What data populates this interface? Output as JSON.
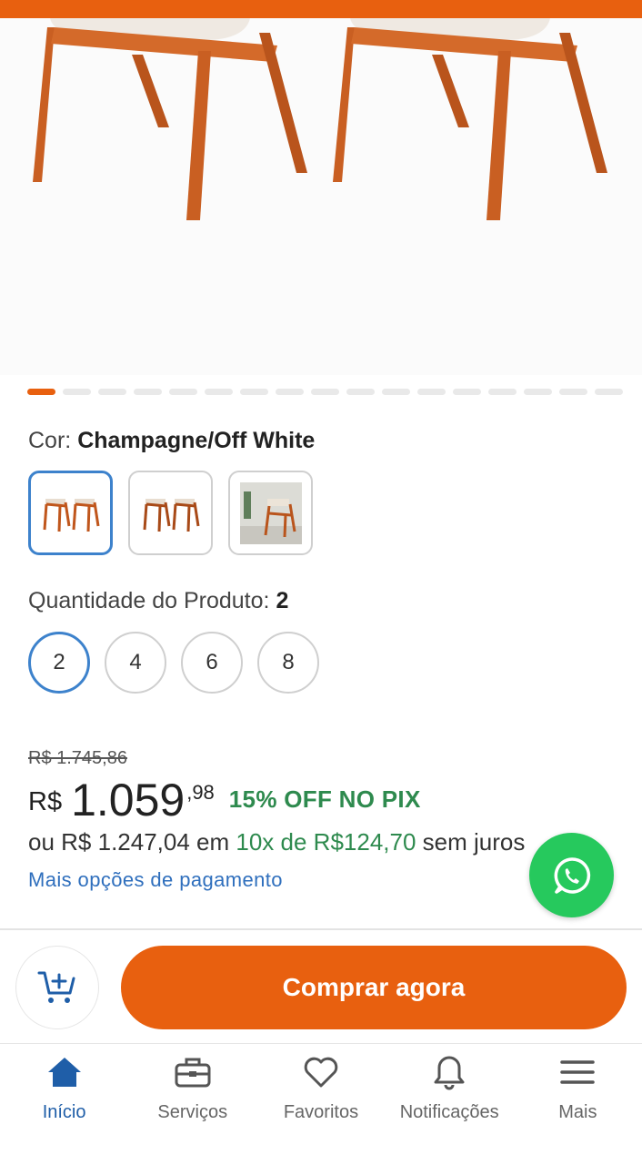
{
  "colors": {
    "accent": "#e8600f",
    "selected_border": "#3d82cc",
    "green": "#2e8a4e",
    "link_blue": "#2f6fbd",
    "nav_active": "#1f5ea8",
    "whatsapp": "#26c95d"
  },
  "carousel": {
    "total_slides": 17,
    "active_index": 0
  },
  "color_selector": {
    "label": "Cor:",
    "value": "Champagne/Off White",
    "swatches": [
      "chairs-pair-front",
      "chairs-pair-side",
      "chair-room-scene"
    ],
    "selected_index": 0
  },
  "quantity": {
    "label": "Quantidade do Produto:",
    "value": "2",
    "options": [
      "2",
      "4",
      "6",
      "8"
    ],
    "selected_index": 0
  },
  "price": {
    "old": "R$ 1.745,86",
    "currency": "R$",
    "main": "1.059",
    "cents": ",98",
    "pix_off": "15% OFF NO PIX",
    "installments_prefix": "ou R$ 1.247,04 em",
    "installments_green": "10x de R$124,70",
    "installments_suffix": "sem juros",
    "more_options": "Mais opções de pagamento"
  },
  "actions": {
    "cart_icon": "add-to-cart-icon",
    "buy_label": "Comprar agora",
    "whatsapp_icon": "whatsapp-icon"
  },
  "nav": {
    "items": [
      {
        "label": "Início",
        "icon": "home-icon",
        "active": true
      },
      {
        "label": "Serviços",
        "icon": "toolbox-icon",
        "active": false
      },
      {
        "label": "Favoritos",
        "icon": "heart-icon",
        "active": false
      },
      {
        "label": "Notificações",
        "icon": "bell-icon",
        "active": false
      },
      {
        "label": "Mais",
        "icon": "menu-icon",
        "active": false
      }
    ]
  }
}
